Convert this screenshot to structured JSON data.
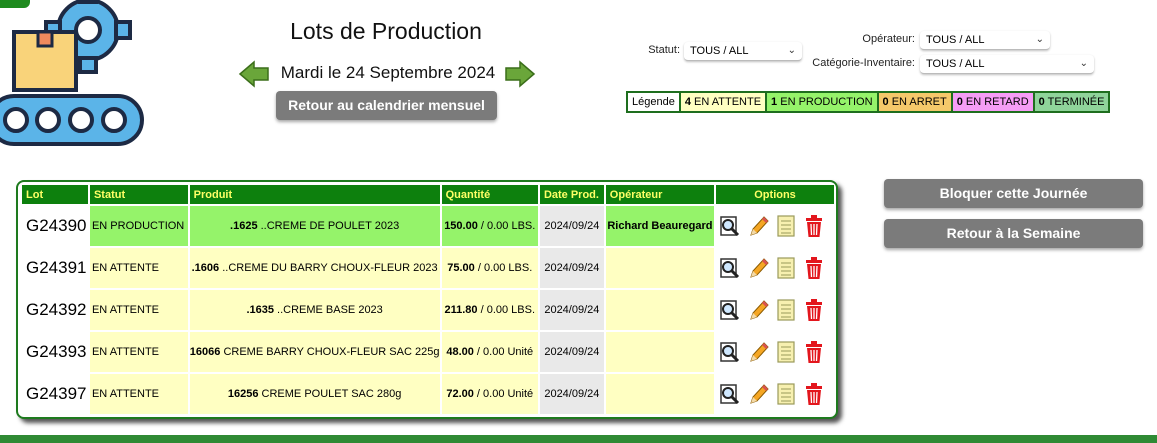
{
  "header": {
    "title": "Lots de Production",
    "date": "Mardi le 24 Septembre 2024",
    "calendar_button": "Retour au calendrier mensuel"
  },
  "filters": {
    "statut_label": "Statut:",
    "statut_value": "TOUS / ALL",
    "operateur_label": "Opérateur:",
    "operateur_value": "TOUS / ALL",
    "categorie_label": "Catégorie-Inventaire:",
    "categorie_value": "TOUS / ALL"
  },
  "legend": {
    "label": "Légende",
    "items": [
      {
        "count": "4",
        "text": "EN ATTENTE",
        "color": "#ffffc2"
      },
      {
        "count": "1",
        "text": "EN PRODUCTION",
        "color": "#95f36a"
      },
      {
        "count": "0",
        "text": "EN ARRET",
        "color": "#f5c86a"
      },
      {
        "count": "0",
        "text": "EN RETARD",
        "color": "#f59df5"
      },
      {
        "count": "0",
        "text": "TERMINÉE",
        "color": "#8fd49a"
      }
    ]
  },
  "table": {
    "headers": [
      "Lot",
      "Statut",
      "Produit",
      "Quantité",
      "Date Prod.",
      "Opérateur",
      "Options"
    ],
    "rows": [
      {
        "lot": "G24390",
        "statut": "EN PRODUCTION",
        "code": ".1625",
        "produit": " ..CREME DE POULET 2023",
        "qte_main": "150.00",
        "qte_rest": " / 0.00 LBS.",
        "date": "2024/09/24",
        "operateur": "Richard Beauregard"
      },
      {
        "lot": "G24391",
        "statut": "EN ATTENTE",
        "code": ".1606",
        "produit": " ..CREME DU BARRY CHOUX-FLEUR 2023",
        "qte_main": "75.00",
        "qte_rest": " / 0.00 LBS.",
        "date": "2024/09/24",
        "operateur": ""
      },
      {
        "lot": "G24392",
        "statut": "EN ATTENTE",
        "code": ".1635",
        "produit": " ..CREME BASE 2023",
        "qte_main": "211.80",
        "qte_rest": " / 0.00 LBS.",
        "date": "2024/09/24",
        "operateur": ""
      },
      {
        "lot": "G24393",
        "statut": "EN ATTENTE",
        "code": "16066",
        "produit": " CREME BARRY CHOUX-FLEUR SAC 225g",
        "qte_main": "48.00",
        "qte_rest": " / 0.00 Unité",
        "date": "2024/09/24",
        "operateur": ""
      },
      {
        "lot": "G24397",
        "statut": "EN ATTENTE",
        "code": "16256",
        "produit": " CREME POULET SAC 280g",
        "qte_main": "72.00",
        "qte_rest": " / 0.00 Unité",
        "date": "2024/09/24",
        "operateur": ""
      }
    ],
    "row_icons": [
      "search-icon",
      "pencil-icon",
      "notepad-icon",
      "trash-icon"
    ]
  },
  "side": {
    "block_button": "Bloquer cette Journée",
    "week_button": "Retour à la Semaine"
  }
}
